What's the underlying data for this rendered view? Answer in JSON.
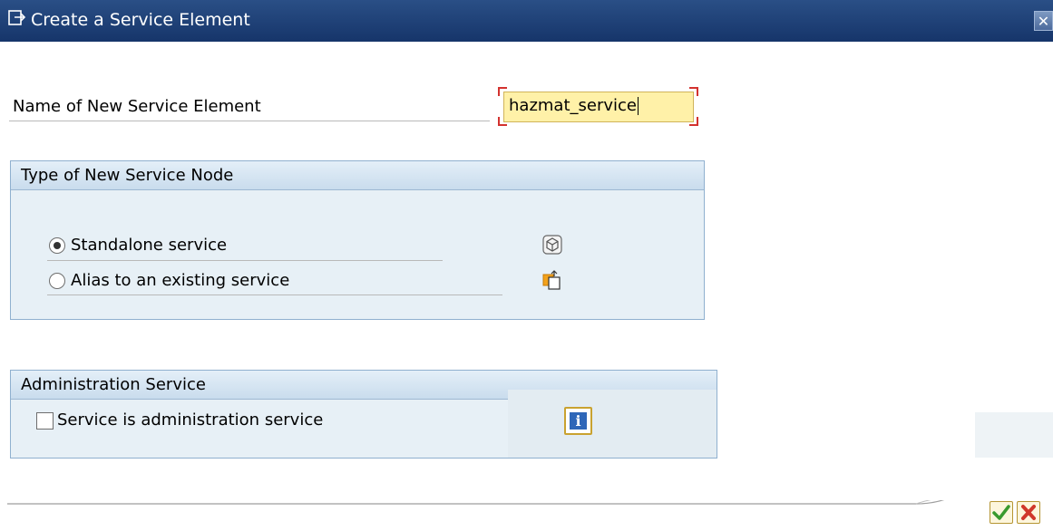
{
  "window": {
    "title": "Create a Service Element",
    "title_icon": "dialog-icon",
    "close_icon": "close-icon"
  },
  "form": {
    "name_label": "Name of New Service Element",
    "name_value": "hazmat_service"
  },
  "type_group": {
    "header": "Type of New Service Node",
    "options": [
      {
        "label": "Standalone service",
        "selected": true,
        "icon": "service-cube-icon"
      },
      {
        "label": "Alias to an existing service",
        "selected": false,
        "icon": "alias-folder-icon"
      }
    ]
  },
  "admin_group": {
    "header": "Administration Service",
    "checkbox_label": "Service is administration service",
    "checked": false,
    "info_icon": "info-icon"
  },
  "footer": {
    "ok_icon": "checkmark-icon",
    "cancel_icon": "cancel-x-icon"
  },
  "colors": {
    "titlebar": "#1e4079",
    "input_bg": "#fff1a8",
    "group_bg": "#e7f0f6",
    "group_border": "#8fb0cf",
    "ok_green": "#3a9a2e",
    "cancel_red": "#d0382b"
  }
}
